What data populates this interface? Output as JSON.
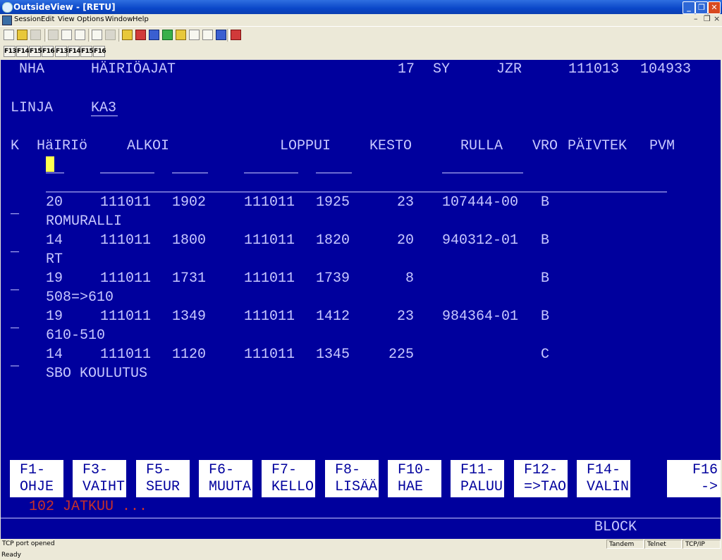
{
  "window": {
    "title": "OutsideView - [RETU]"
  },
  "menu": [
    "Session",
    "Edit",
    "View",
    "Options",
    "Window",
    "Help"
  ],
  "fkeys_toolbar": [
    "F13",
    "F14",
    "F15",
    "F16",
    "F13",
    "F14",
    "F15",
    "F16"
  ],
  "header": {
    "left": "NHA",
    "title": "HÄIRIÖAJAT",
    "num": "17",
    "sy": "SY",
    "user": "JZR",
    "date": "111013",
    "time": "104933"
  },
  "line": {
    "label": "LINJA",
    "value": "KA3"
  },
  "columns": {
    "k": "K",
    "hairio": "HäIRIö",
    "alkoi": "ALKOI",
    "loppui": "LOPPUI",
    "kesto": "KESTO",
    "rulla": "RULLA",
    "vro": "VRO",
    "paivtek": "PÄIVTEK",
    "pvm": "PVM"
  },
  "rows": [
    {
      "sel": "_",
      "code": "20",
      "d1": "111011",
      "t1": "1902",
      "d2": "111011",
      "t2": "1925",
      "kesto": "23",
      "rulla": "107444-00",
      "vro": "B",
      "desc": "ROMURALLI"
    },
    {
      "sel": "_",
      "code": "14",
      "d1": "111011",
      "t1": "1800",
      "d2": "111011",
      "t2": "1820",
      "kesto": "20",
      "rulla": "940312-01",
      "vro": "B",
      "desc": "RT"
    },
    {
      "sel": "_",
      "code": "19",
      "d1": "111011",
      "t1": "1731",
      "d2": "111011",
      "t2": "1739",
      "kesto": "8",
      "rulla": "",
      "vro": "B",
      "desc": "508=>610"
    },
    {
      "sel": "_",
      "code": "19",
      "d1": "111011",
      "t1": "1349",
      "d2": "111011",
      "t2": "1412",
      "kesto": "23",
      "rulla": "984364-01",
      "vro": "B",
      "desc": "610-510"
    },
    {
      "sel": "_",
      "code": "14",
      "d1": "111011",
      "t1": "1120",
      "d2": "111011",
      "t2": "1345",
      "kesto": "225",
      "rulla": "",
      "vro": "C",
      "desc": "SBO KOULUTUS"
    }
  ],
  "function_keys": [
    {
      "key": "F1-",
      "label": "OHJE"
    },
    {
      "key": "F3-",
      "label": "VAIHT"
    },
    {
      "key": "F5-",
      "label": "SEUR"
    },
    {
      "key": "F6-",
      "label": "MUUTA"
    },
    {
      "key": "F7-",
      "label": "KELLO"
    },
    {
      "key": "F8-",
      "label": "LISÄÄ"
    },
    {
      "key": "F10-",
      "label": "HAE"
    },
    {
      "key": "F11-",
      "label": "PALUU"
    },
    {
      "key": "F12-",
      "label": "=>TAO"
    },
    {
      "key": "F14-",
      "label": "VALIN"
    },
    {
      "key": "F16",
      "label": "->"
    }
  ],
  "message": "102 JATKUU ...",
  "mode": "BLOCK",
  "status": {
    "left": "TCP port opened",
    "host": "Tandem",
    "protocol": "Telnet",
    "transport": "TCP/IP",
    "ready": "Ready"
  },
  "colors": {
    "terminal_bg": "#00009d",
    "terminal_fg": "#c8c8ff",
    "cursor": "#ffff50",
    "message": "#c8302a"
  }
}
